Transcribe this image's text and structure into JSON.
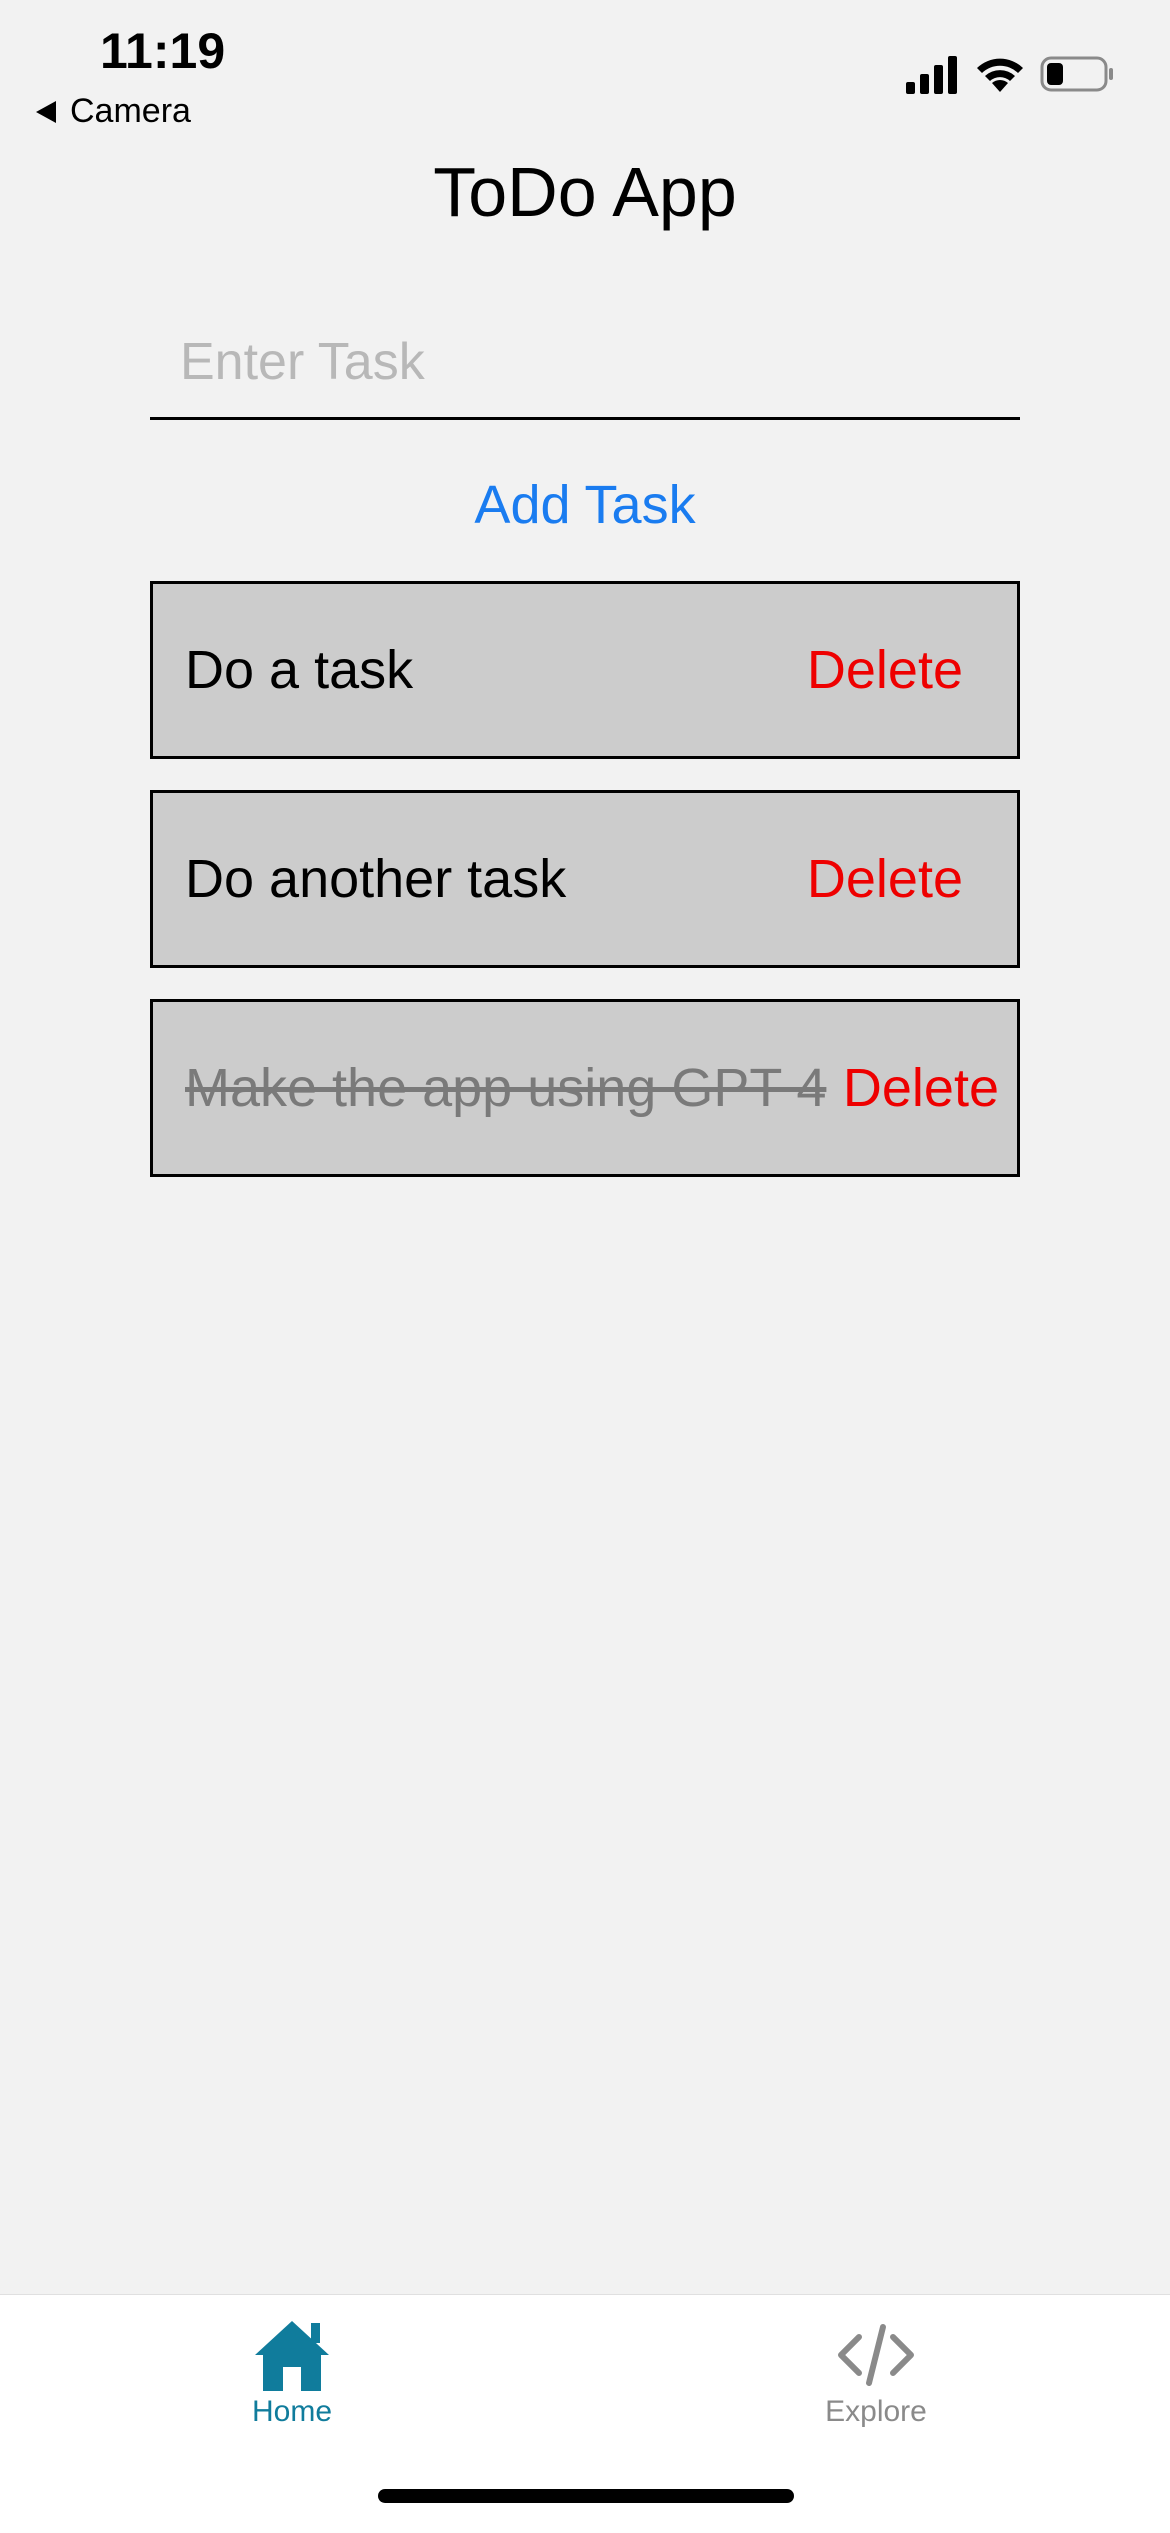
{
  "status_bar": {
    "time": "11:19",
    "back_label": "Camera",
    "icons": [
      "signal-icon",
      "wifi-icon",
      "battery-icon"
    ]
  },
  "header": {
    "title": "ToDo App"
  },
  "task_input": {
    "value": "",
    "placeholder": "Enter Task"
  },
  "add_button": {
    "label": "Add Task"
  },
  "tasks": [
    {
      "text": "Do a task",
      "completed": false,
      "delete_label": "Delete"
    },
    {
      "text": "Do another task",
      "completed": false,
      "delete_label": "Delete"
    },
    {
      "text": "Make the app using GPT 4",
      "completed": true,
      "delete_label": "Delete"
    }
  ],
  "tab_bar": {
    "items": [
      {
        "label": "Home",
        "icon": "house-icon",
        "active": true
      },
      {
        "label": "Explore",
        "icon": "code-icon",
        "active": false
      }
    ]
  },
  "colors": {
    "background": "#f2f2f2",
    "accent": "#1a7cf0",
    "delete": "#ee0000",
    "task_background": "#cccccc",
    "tab_active": "#107c9c",
    "tab_inactive": "#8a8a8a"
  }
}
